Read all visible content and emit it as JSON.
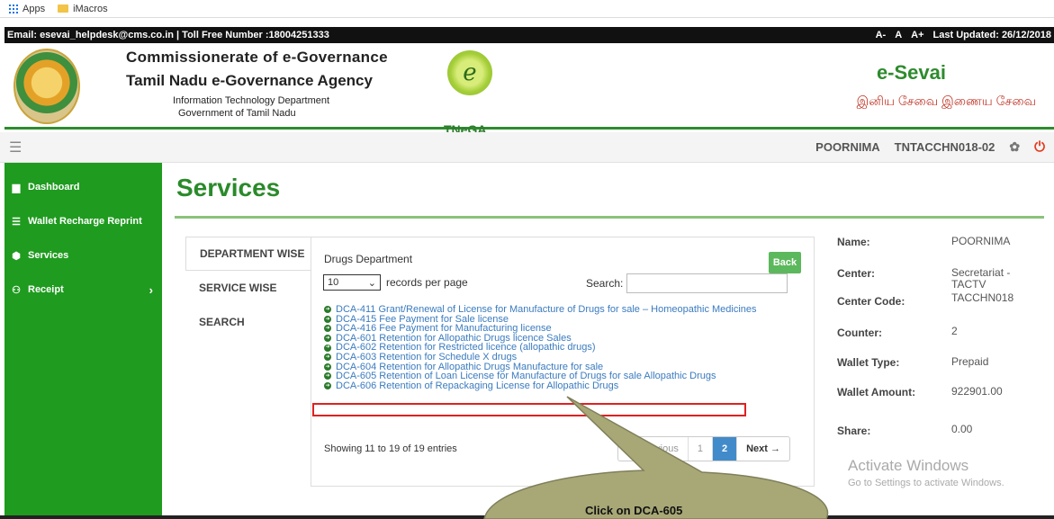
{
  "bookmarks": {
    "apps": "Apps",
    "imacros": "iMacros"
  },
  "topbar": {
    "contact": "Email: esevai_helpdesk@cms.co.in | Toll Free Number :18004251333",
    "font_small": "A-",
    "font_normal": "A",
    "font_large": "A+",
    "last_updated": "Last Updated: 26/12/2018"
  },
  "header": {
    "org_line1": "Commissionerate of e-Governance",
    "org_line2": "Tamil Nadu e-Governance Agency",
    "org_line3": "Information Technology Department",
    "org_line4": "Government of Tamil Nadu",
    "tnega": "TNeGA",
    "brand": "e-Sevai",
    "tagline": "இனிய சேவை இணைய சேவை"
  },
  "user": {
    "name": "POORNIMA",
    "code": "TNTACCHN018-02"
  },
  "sidebar": {
    "items": [
      {
        "label": "Dashboard",
        "icon": "dashboard-icon"
      },
      {
        "label": "Wallet Recharge Reprint",
        "icon": "wallet-icon"
      },
      {
        "label": "Services",
        "icon": "services-icon"
      },
      {
        "label": "Receipt",
        "icon": "receipt-icon"
      }
    ]
  },
  "page": {
    "title": "Services"
  },
  "tabs": [
    "DEPARTMENT WISE",
    "SERVICE WISE",
    "SEARCH"
  ],
  "panel": {
    "department": "Drugs Department",
    "back": "Back",
    "records_value": "10",
    "records_label": "records per page",
    "search_label": "Search:",
    "services": [
      "DCA-411 Grant/Renewal of License for Manufacture of Drugs for sale – Homeopathic Medicines",
      "DCA-415 Fee Payment for Sale license",
      "DCA-416 Fee Payment for Manufacturing license",
      "DCA-601 Retention for Allopathic Drugs licence Sales",
      "DCA-602 Retention for Restricted licence (allopathic drugs)",
      "DCA-603 Retention for Schedule X drugs",
      "DCA-604 Retention for Allopathic Drugs Manufacture for sale",
      "DCA-605 Retention of Loan License for Manufacture of Drugs for sale Allopathic Drugs",
      "DCA-606 Retention of Repackaging License for Allopathic Drugs"
    ],
    "showing": "Showing 11 to 19 of 19 entries",
    "pager": {
      "prev": "← Previous",
      "p1": "1",
      "p2": "2",
      "next": "Next →"
    }
  },
  "info": {
    "name_label": "Name:",
    "name_value": "POORNIMA",
    "center_label": "Center:",
    "center_value": "Secretariat - TACTV",
    "center_code_label": "Center Code:",
    "center_code_value": "TACCHN018",
    "counter_label": "Counter:",
    "counter_value": "2",
    "wallet_type_label": "Wallet Type:",
    "wallet_type_value": "Prepaid",
    "wallet_amount_label": "Wallet Amount:",
    "wallet_amount_value": "922901.00",
    "share_label": "Share:",
    "share_value": "0.00"
  },
  "watermark": {
    "title": "Activate Windows",
    "subtitle": "Go to Settings to activate Windows."
  },
  "callout": {
    "text": "Click on DCA-605"
  },
  "colors": {
    "green": "#1f9b1f",
    "link": "#3a7bbf",
    "highlight": "#e02020"
  }
}
